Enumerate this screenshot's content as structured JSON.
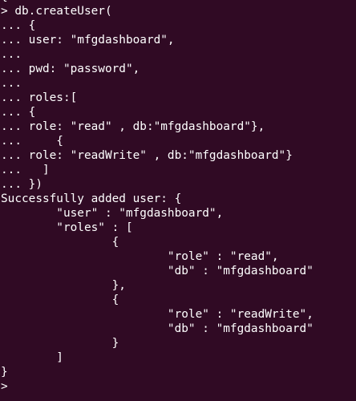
{
  "terminal": {
    "background": "#300a24",
    "foreground": "#ffffff",
    "lines": [
      "{...",
      "> db.createUser(",
      "... {",
      "... user: \"mfgdashboard\",",
      "...",
      "... pwd: \"password\",",
      "...",
      "... roles:[",
      "... {",
      "... role: \"read\" , db:\"mfgdashboard\"},",
      "...     {",
      "... role: \"readWrite\" , db:\"mfgdashboard\"}",
      "...   ]",
      "... })",
      "Successfully added user: {",
      "        \"user\" : \"mfgdashboard\",",
      "        \"roles\" : [",
      "                {",
      "                        \"role\" : \"read\",",
      "                        \"db\" : \"mfgdashboard\"",
      "                },",
      "                {",
      "                        \"role\" : \"readWrite\",",
      "                        \"db\" : \"mfgdashboard\"",
      "                }",
      "        ]",
      "}",
      "> "
    ]
  }
}
